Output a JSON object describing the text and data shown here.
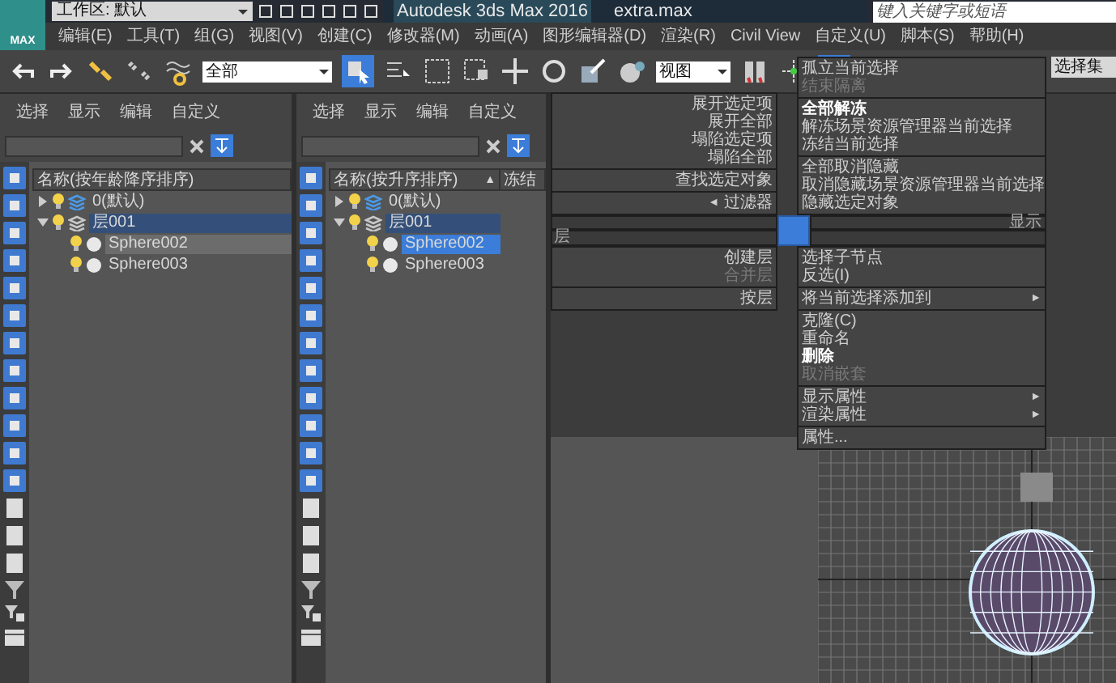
{
  "title_bar": {
    "logo_text": "MAX",
    "workspace": "工作区: 默认",
    "app_title": "Autodesk 3ds Max 2016",
    "file_name": "extra.max",
    "search": {
      "placeholder": "键入关键字或短语"
    }
  },
  "menu_bar": [
    "编辑(E)",
    "工具(T)",
    "组(G)",
    "视图(V)",
    "创建(C)",
    "修改器(M)",
    "动画(A)",
    "图形编辑器(D)",
    "渲染(R)",
    "Civil View",
    "自定义(U)",
    "脚本(S)",
    "帮助(H)"
  ],
  "toolbar": {
    "selection_filter": "全部",
    "select_object_active": true,
    "reference_coordinate": "视图",
    "named_selection": "选择集"
  },
  "explorers": [
    {
      "focused": false,
      "menu": [
        "选择",
        "显示",
        "编辑",
        "自定义"
      ],
      "columns": [
        {
          "label": "名称(按年龄降序排序)"
        }
      ],
      "tree": [
        {
          "label": "0(默认)",
          "kind": "layer",
          "current": true,
          "expanded": false,
          "selected": false
        },
        {
          "label": "层001",
          "kind": "layer",
          "current": false,
          "expanded": true,
          "selected": true,
          "children": [
            {
              "label": "Sphere002",
              "kind": "object",
              "selected": true
            },
            {
              "label": "Sphere003",
              "kind": "object",
              "selected": false
            }
          ]
        }
      ]
    },
    {
      "focused": true,
      "menu": [
        "选择",
        "显示",
        "编辑",
        "自定义"
      ],
      "columns": [
        {
          "label": "名称(按升序排序)",
          "sort_indicator": "▲"
        },
        {
          "label": "冻结"
        }
      ],
      "tree": [
        {
          "label": "0(默认)",
          "kind": "layer",
          "current": true,
          "expanded": false,
          "selected": false
        },
        {
          "label": "层001",
          "kind": "layer",
          "current": false,
          "expanded": true,
          "selected": true,
          "children": [
            {
              "label": "Sphere002",
              "kind": "object",
              "selected": true
            },
            {
              "label": "Sphere003",
              "kind": "object",
              "selected": false
            }
          ]
        }
      ]
    }
  ],
  "quad_menu": {
    "upper_left": {
      "groups": [
        [
          {
            "label": "展开选定项",
            "disabled": false,
            "bold": false
          },
          {
            "label": "展开全部",
            "disabled": false,
            "bold": false
          },
          {
            "label": "塌陷选定项",
            "disabled": false,
            "bold": false
          },
          {
            "label": "塌陷全部",
            "disabled": false,
            "bold": false
          }
        ],
        [
          {
            "label": "查找选定对象",
            "disabled": false,
            "bold": false
          }
        ],
        [
          {
            "label": "过滤器",
            "disabled": false,
            "bold": false,
            "arrow": "◄"
          }
        ]
      ]
    },
    "upper_right": {
      "label": "显示",
      "groups": [
        [
          {
            "label": "孤立当前选择",
            "disabled": false,
            "bold": false
          },
          {
            "label": "结束隔离",
            "disabled": true,
            "bold": false
          }
        ],
        [
          {
            "label": "全部解冻",
            "disabled": false,
            "bold": true
          },
          {
            "label": "解冻场景资源管理器当前选择",
            "disabled": false,
            "bold": false
          },
          {
            "label": "冻结当前选择",
            "disabled": false,
            "bold": false
          }
        ],
        [
          {
            "label": "全部取消隐藏",
            "disabled": false,
            "bold": false
          },
          {
            "label": "取消隐藏场景资源管理器当前选择",
            "disabled": false,
            "bold": false
          },
          {
            "label": "隐藏选定对象",
            "disabled": false,
            "bold": false
          }
        ]
      ]
    },
    "lower_left": {
      "label": "层",
      "groups": [
        [
          {
            "label": "创建层",
            "disabled": false,
            "bold": false
          },
          {
            "label": "合并层",
            "disabled": true,
            "bold": false
          }
        ],
        [
          {
            "label": "按层",
            "disabled": false,
            "bold": false
          }
        ]
      ]
    },
    "lower_right": {
      "groups": [
        [
          {
            "label": "选择子节点",
            "disabled": false,
            "bold": false
          },
          {
            "label": "反选(I)",
            "disabled": false,
            "bold": false
          }
        ],
        [
          {
            "label": "将当前选择添加到",
            "disabled": false,
            "bold": false,
            "arrow": "►"
          }
        ],
        [
          {
            "label": "克隆(C)",
            "disabled": false,
            "bold": false
          },
          {
            "label": "重命名",
            "disabled": false,
            "bold": false
          },
          {
            "label": "删除",
            "disabled": false,
            "bold": true
          },
          {
            "label": "取消嵌套",
            "disabled": true,
            "bold": false
          }
        ],
        [
          {
            "label": "显示属性",
            "disabled": false,
            "bold": false,
            "arrow": "►"
          },
          {
            "label": "渲染属性",
            "disabled": false,
            "bold": false,
            "arrow": "►"
          }
        ],
        [
          {
            "label": "属性...",
            "disabled": false,
            "bold": false
          }
        ]
      ]
    }
  }
}
